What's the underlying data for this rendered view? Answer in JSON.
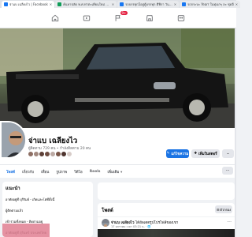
{
  "browser": {
    "tabs": [
      {
        "title": "จ่าแบ เฉลียงไว | Facebook",
        "icon_color": "#1877f2",
        "active": true
      },
      {
        "title": "ค้นหาปลัด พ.ศ.ท่าตะเคียนใหม่ 2 การ",
        "icon_color": "#0f9d58",
        "active": false
      },
      {
        "title": "รถบรรทุก5อยู่ตู้บรรทุก ตีฟีรา วันดินธุรกิจ",
        "icon_color": "#1877f2",
        "active": false
      },
      {
        "title": "รถกระบะ Yearr ในทุ่งเก่ๆ ละ ชุดอี",
        "icon_color": "#1877f2",
        "active": false
      }
    ],
    "close_glyph": "✕"
  },
  "nav": {
    "icons": [
      "home-icon",
      "video-icon",
      "flag-icon",
      "marketplace-icon",
      "groups-icon"
    ],
    "badge": "9+"
  },
  "profile": {
    "name": "จ่าแบ เฉลียงไว",
    "followers": "ผู้ติดตาม 729 คน • กำลังติดตาม 20 คน",
    "friend_avatar_colors": [
      "#8d6e63",
      "#a1887f",
      "#5d4037",
      "#6d4c41",
      "#bcaaa4",
      "#795548",
      "#4e342e",
      "#d7ccc8"
    ],
    "buttons": {
      "edit": "แก้ไขความ",
      "story": "เพิ่มในสตอรี่",
      "more": "⌄"
    }
  },
  "tabs": [
    {
      "label": "โพสต์",
      "active": true
    },
    {
      "label": "เกี่ยวกับ",
      "active": false
    },
    {
      "label": "เพื่อน",
      "active": false
    },
    {
      "label": "รูปภาพ",
      "active": false
    },
    {
      "label": "วิดีโอ",
      "active": false
    },
    {
      "label": "Reels",
      "active": false
    },
    {
      "label": "เพิ่มเติม ▾",
      "active": false
    }
  ],
  "tabs_more": "···",
  "intro": {
    "title": "แนะนำ",
    "lines": [
      "อาศัยอยู่ที่ บุรีรัมย์ - เกิดและโตที่ตั้งนี้",
      "ผู้ติดตามแล้ว",
      "เข้าร่วมทั้งหมด - ติดตามอยู่",
      "อาศัยอยู่ที่ สุรินทร์ ประเทศไทย"
    ]
  },
  "posts": {
    "title": "โพสต์",
    "filter": "ตัวกรอง",
    "post": {
      "author": "จ่าแบ เฉลียงไว",
      "action": "ได้อัพเดตรูปโปรไฟล์ของเขา",
      "time": "17 มกราคม เวลา 03:21 น. · 🌐",
      "dots": "···"
    }
  },
  "colors": {
    "accent": "#1b74e4",
    "fb_bg": "#f0f2f5",
    "badge": "#e41e3f"
  }
}
